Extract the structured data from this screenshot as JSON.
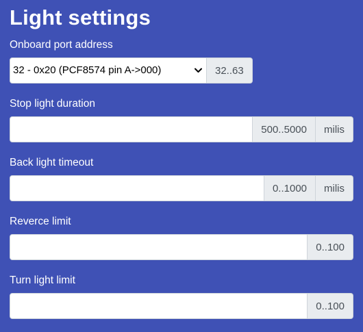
{
  "title": "Light settings",
  "fields": {
    "port": {
      "label": "Onboard port address",
      "selected": "32 - 0x20 (PCF8574 pin A->000)",
      "range": "32..63"
    },
    "stop": {
      "label": "Stop light duration",
      "value": "",
      "range": "500..5000",
      "unit": "milis"
    },
    "back": {
      "label": "Back light timeout",
      "value": "",
      "range": "0..1000",
      "unit": "milis"
    },
    "reverse": {
      "label": "Reverce limit",
      "value": "",
      "range": "0..100"
    },
    "turn": {
      "label": "Turn light limit",
      "value": "",
      "range": "0..100"
    }
  },
  "colors": {
    "background": "#3f51b5",
    "addon": "#e9ecef",
    "border": "#ced4da"
  },
  "icons": {
    "select": "chevron-down-icon"
  }
}
